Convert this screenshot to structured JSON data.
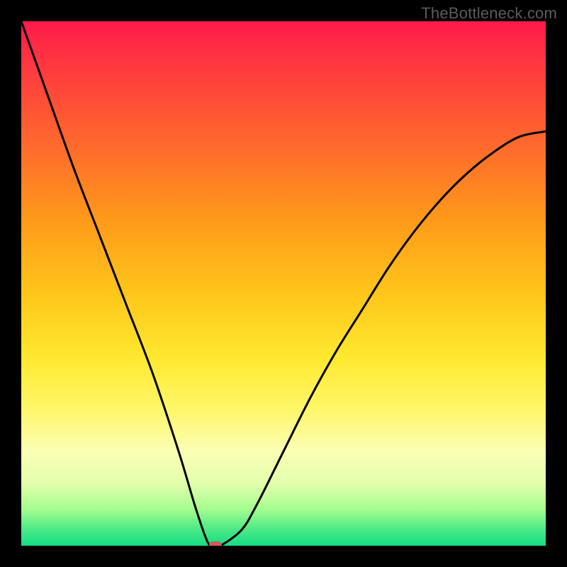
{
  "watermark": "TheBottleneck.com",
  "colors": {
    "frame": "#000000",
    "curve_stroke": "#000000",
    "marker_fill": "#d55b52"
  },
  "chart_data": {
    "type": "line",
    "title": "",
    "xlabel": "",
    "ylabel": "",
    "xlim": [
      0,
      100
    ],
    "ylim": [
      0,
      100
    ],
    "grid": false,
    "series": [
      {
        "name": "bottleneck-curve",
        "x": [
          0,
          5,
          10,
          15,
          20,
          25,
          30,
          33,
          35,
          36,
          37,
          38,
          42,
          45,
          50,
          55,
          60,
          65,
          70,
          75,
          80,
          85,
          90,
          95,
          100
        ],
        "y": [
          100,
          86,
          72,
          59,
          46,
          33,
          18,
          8,
          2,
          0,
          0,
          0,
          3,
          8,
          18,
          28,
          37,
          45,
          53,
          60,
          66,
          71,
          75,
          78,
          79
        ]
      }
    ],
    "marker": {
      "x": 37,
      "y": 0
    },
    "gradient_stops": [
      {
        "pos": 0,
        "color": "#ff1a4b"
      },
      {
        "pos": 10,
        "color": "#ff3d3d"
      },
      {
        "pos": 25,
        "color": "#ff6e2b"
      },
      {
        "pos": 38,
        "color": "#ff9a1a"
      },
      {
        "pos": 52,
        "color": "#ffc61a"
      },
      {
        "pos": 64,
        "color": "#ffe82e"
      },
      {
        "pos": 74,
        "color": "#fff76a"
      },
      {
        "pos": 82,
        "color": "#fbffb5"
      },
      {
        "pos": 88,
        "color": "#e3ffad"
      },
      {
        "pos": 93,
        "color": "#a6fd8f"
      },
      {
        "pos": 97,
        "color": "#49e986"
      },
      {
        "pos": 100,
        "color": "#14dd84"
      }
    ]
  }
}
